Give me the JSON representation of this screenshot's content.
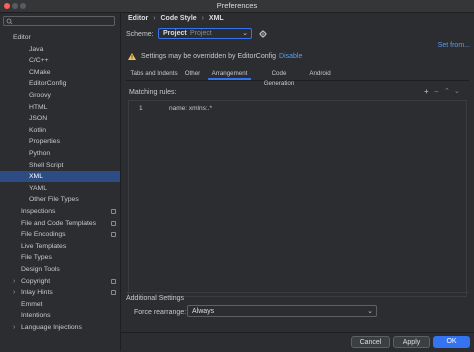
{
  "window": {
    "title": "Preferences"
  },
  "sidebar": {
    "search_placeholder": "",
    "items": [
      {
        "label": "Editor",
        "level": 0,
        "settings": false
      },
      {
        "label": "Java",
        "level": 2,
        "settings": false
      },
      {
        "label": "C/C++",
        "level": 2,
        "settings": false
      },
      {
        "label": "CMake",
        "level": 2,
        "settings": false
      },
      {
        "label": "EditorConfig",
        "level": 2,
        "settings": false
      },
      {
        "label": "Groovy",
        "level": 2,
        "settings": false
      },
      {
        "label": "HTML",
        "level": 2,
        "settings": false
      },
      {
        "label": "JSON",
        "level": 2,
        "settings": false
      },
      {
        "label": "Kotlin",
        "level": 2,
        "settings": false
      },
      {
        "label": "Properties",
        "level": 2,
        "settings": false
      },
      {
        "label": "Python",
        "level": 2,
        "settings": false
      },
      {
        "label": "Shell Script",
        "level": 2,
        "settings": false
      },
      {
        "label": "XML",
        "level": 2,
        "selected": true,
        "settings": false
      },
      {
        "label": "YAML",
        "level": 2,
        "settings": false
      },
      {
        "label": "Other File Types",
        "level": 2,
        "settings": false
      },
      {
        "label": "Inspections",
        "level": 1,
        "settings": true
      },
      {
        "label": "File and Code Templates",
        "level": 1,
        "settings": true
      },
      {
        "label": "File Encodings",
        "level": 1,
        "settings": true
      },
      {
        "label": "Live Templates",
        "level": 1,
        "settings": false
      },
      {
        "label": "File Types",
        "level": 1,
        "settings": false
      },
      {
        "label": "Design Tools",
        "level": 1,
        "settings": false
      },
      {
        "label": "Copyright",
        "level": 1,
        "expand": true,
        "settings": true
      },
      {
        "label": "Inlay Hints",
        "level": 1,
        "expand": true,
        "settings": true
      },
      {
        "label": "Emmet",
        "level": 1,
        "settings": false
      },
      {
        "label": "Intentions",
        "level": 1,
        "settings": false
      },
      {
        "label": "Language Injections",
        "level": 1,
        "expand": true,
        "settings": false
      }
    ]
  },
  "breadcrumb": [
    "Editor",
    "Code Style",
    "XML"
  ],
  "scheme": {
    "label": "Scheme:",
    "value": "Project",
    "hint": "Project",
    "set_from": "Set from..."
  },
  "warning": {
    "text": "Settings may be overridden by EditorConfig",
    "link": "Disable"
  },
  "tabs": [
    {
      "label": "Tabs and Indents"
    },
    {
      "label": "Other"
    },
    {
      "label": "Arrangement",
      "active": true
    },
    {
      "label": "Code Generation"
    },
    {
      "label": "Android"
    }
  ],
  "matching": {
    "label": "Matching rules:",
    "rule_index": "1",
    "rule_text": "name: xmlns:.*"
  },
  "additional": {
    "label": "Additional Settings",
    "force_label": "Force rearrange:",
    "force_value": "Always"
  },
  "buttons": {
    "help": "?",
    "cancel": "Cancel",
    "apply": "Apply",
    "ok": "OK"
  }
}
